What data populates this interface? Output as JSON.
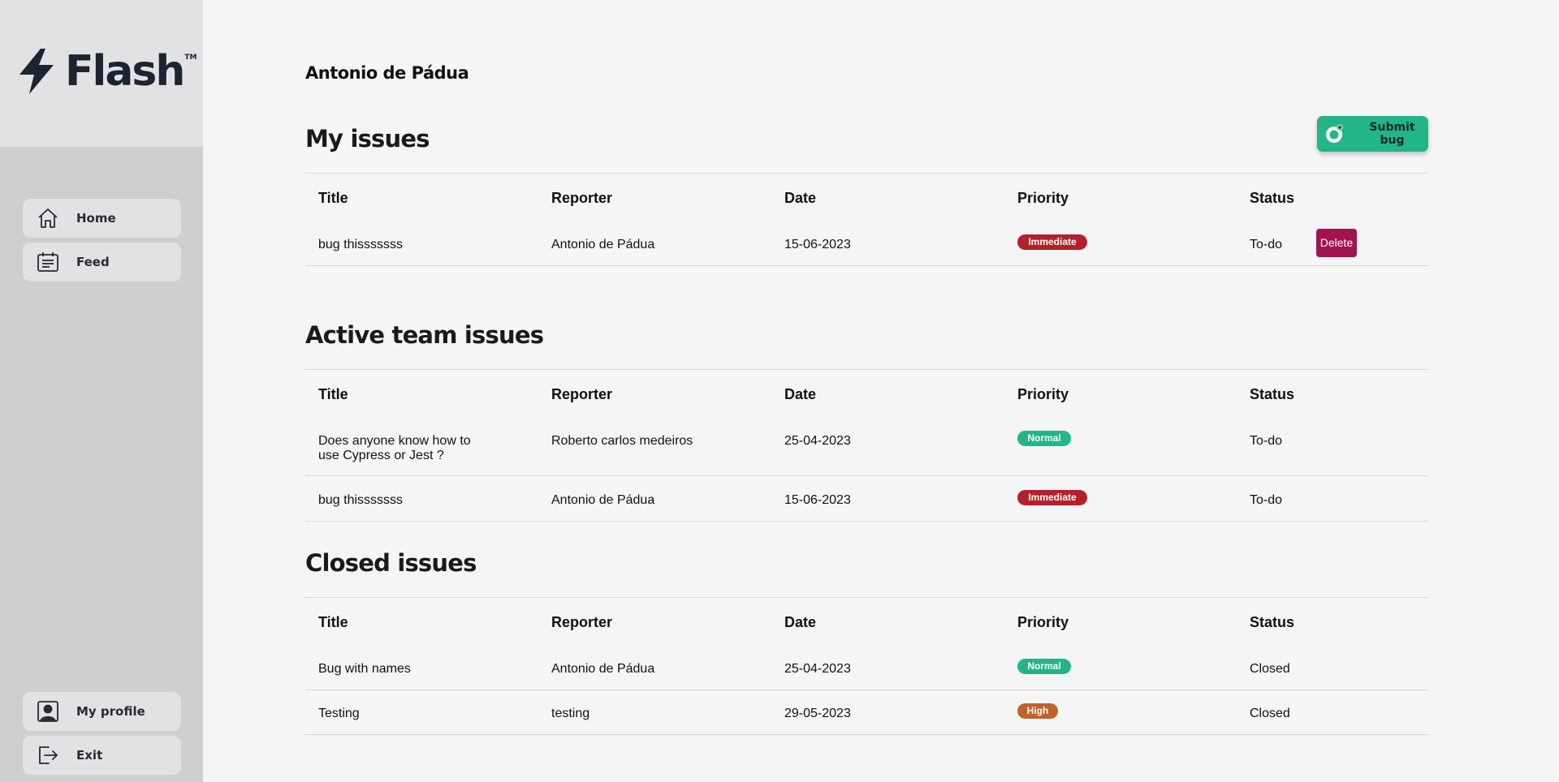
{
  "logo": {
    "text": "Flash",
    "tm": "TM"
  },
  "nav": {
    "home": "Home",
    "feed": "Feed",
    "profile": "My profile",
    "exit": "Exit"
  },
  "user_name": "Antonio de Pádua",
  "submit_button": "Submit bug",
  "headers": {
    "title": "Title",
    "reporter": "Reporter",
    "date": "Date",
    "priority": "Priority",
    "status": "Status"
  },
  "sections": {
    "my_issues": {
      "title": "My issues",
      "rows": [
        {
          "title": "bug thisssssss",
          "reporter": "Antonio de Pádua",
          "date": "15-06-2023",
          "priority": "Immediate",
          "status": "To-do",
          "action": "Delete"
        }
      ]
    },
    "team_issues": {
      "title": "Active team issues",
      "rows": [
        {
          "title": "Does anyone know how to use Cypress or Jest ?",
          "reporter": "Roberto carlos medeiros",
          "date": "25-04-2023",
          "priority": "Normal",
          "status": "To-do"
        },
        {
          "title": "bug thisssssss",
          "reporter": "Antonio de Pádua",
          "date": "15-06-2023",
          "priority": "Immediate",
          "status": "To-do"
        }
      ]
    },
    "closed_issues": {
      "title": "Closed issues",
      "rows": [
        {
          "title": "Bug with names",
          "reporter": "Antonio de Pádua",
          "date": "25-04-2023",
          "priority": "Normal",
          "status": "Closed"
        },
        {
          "title": "Testing",
          "reporter": "testing",
          "date": "29-05-2023",
          "priority": "High",
          "status": "Closed"
        }
      ]
    }
  },
  "colors": {
    "sidebar": "#cfcfcf",
    "logo_bg": "#e2e2e4",
    "accent": "#22b58a",
    "immediate": "#b3202a",
    "normal": "#22b58a",
    "high": "#c0622a",
    "delete": "#a0154e"
  },
  "icons": {
    "logo": "lightning-bolt-icon",
    "home": "home-icon",
    "feed": "feed-icon",
    "profile": "user-profile-icon",
    "exit": "exit-icon",
    "submit": "bug-icon"
  }
}
